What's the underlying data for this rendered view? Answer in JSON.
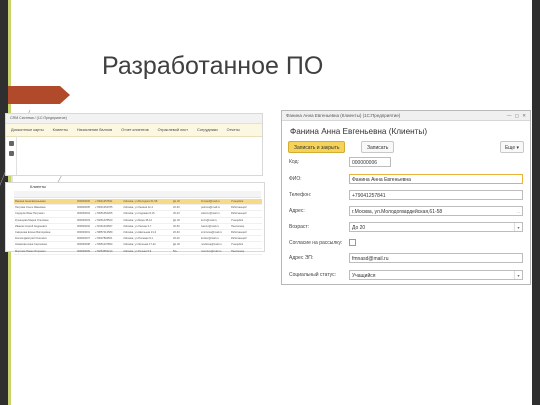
{
  "slide": {
    "title": "Разработанное ПО"
  },
  "left_screenshot": {
    "window_title": "CRM Система / (1С:Предприятие)",
    "menu": [
      "Дисконтные карты",
      "Клиенты",
      "Начисление баллов",
      "Отчет клиентов",
      "Отраслевой лист",
      "Сотрудники",
      "Отчеты"
    ]
  },
  "list_screenshot": {
    "title": "Клиенты",
    "rows": [
      [
        "Фанина Анна Евгеньевна",
        "000000006",
        "+79041257841",
        "г.Москва, ул.Молодогв 61-58",
        "До 20",
        "",
        "fmnasd@mail.ru",
        "Учащийся"
      ],
      [
        "Петрова Ольга Ивановна",
        "000000005",
        "+79031254785",
        "г.Москва, ул.Ленина 12-4",
        "20-30",
        "",
        "petrova@mail.ru",
        "Работающий"
      ],
      [
        "Сидоров Иван Петрович",
        "000000004",
        "+79051452365",
        "г.Москва, ул.Садовая 8-15",
        "30-40",
        "",
        "sidorov@mail.ru",
        "Работающий"
      ],
      [
        "Кузнецова Мария Олеговна",
        "000000003",
        "+79261478523",
        "г.Москва, ул.Мира 45-12",
        "До 20",
        "",
        "kuzn@mail.ru",
        "Учащийся"
      ],
      [
        "Иванов Сергей Андреевич",
        "000000002",
        "+79161234567",
        "г.Москва, ул.Лесная 3-7",
        "40-50",
        "",
        "ivanov@mail.ru",
        "Пенсионер"
      ],
      [
        "Смирнова Елена Викторовна",
        "000000001",
        "+79857412589",
        "г.Москва, ул.Школьная 21-3",
        "20-30",
        "",
        "smirnova@mail.ru",
        "Работающий"
      ],
      [
        "Козлов Дмитрий Олегович",
        "000000007",
        "+79037894561",
        "г.Москва, ул.Полевая 9-1",
        "30-40",
        "",
        "kozlov@mail.ru",
        "Работающий"
      ],
      [
        "Новикова Анна Сергеевна",
        "000000008",
        "+79651237894",
        "г.Москва, ул.Зеленая 17-22",
        "До 20",
        "",
        "novikova@mail.ru",
        "Учащийся"
      ],
      [
        "Морозов Павел Игоревич",
        "000000009",
        "+79254563214",
        "г.Москва, ул.Речная 5-9",
        "50+",
        "",
        "morozov@mail.ru",
        "Пенсионер"
      ]
    ]
  },
  "dialog": {
    "window_title": "Фанина Анна Евгеньевна (Клиенты) (1С:Предприятие)",
    "heading": "Фанина Анна Евгеньевна (Клиенты)",
    "buttons": {
      "save_close": "Записать и закрыть",
      "save": "Записать",
      "more": "Еще ▾",
      "help": "?"
    },
    "fields": {
      "code_label": "Код:",
      "code_value": "000000006",
      "fio_label": "ФИО:",
      "fio_value": "Фанина Анна Евгеньевна",
      "phone_label": "Телефон:",
      "phone_value": "+79041257841",
      "address_label": "Адрес:",
      "address_value": "г.Москва, ул.Молодогвардейская,61-58",
      "age_label": "Возраст:",
      "age_value": "До 20",
      "mailing_label": "Согласие на рассылку:",
      "email_label": "Адрес ЭП:",
      "email_value": "fmnasd@mail.ru",
      "status_label": "Социальный статус:",
      "status_value": "Учащийся"
    }
  },
  "colors": {
    "accent": "#c9d36b",
    "primary_button": "#f5d35a",
    "dark_band": "#2f2f2f",
    "selected_row": "#f7d98a"
  }
}
